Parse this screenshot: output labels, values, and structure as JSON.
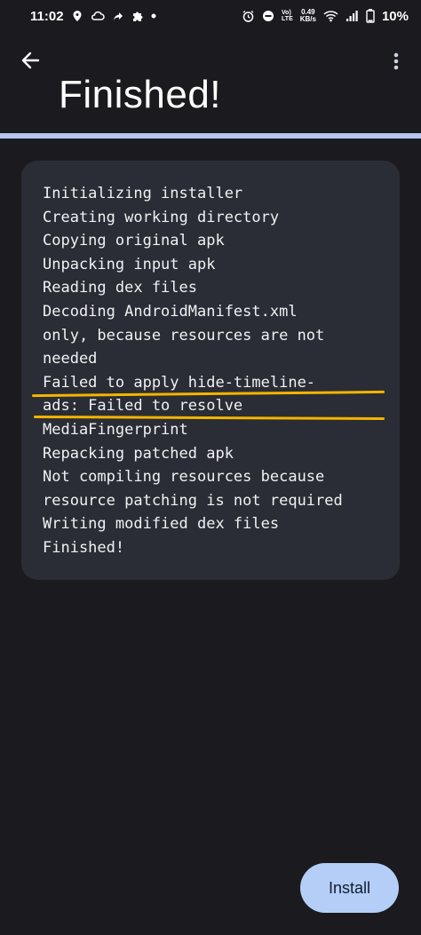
{
  "status_bar": {
    "time": "11:02",
    "volte_top": "Vo)",
    "volte_bottom": "LTE",
    "net_speed_value": "0.49",
    "net_speed_unit": "KB/s",
    "battery": "10%"
  },
  "app_bar": {
    "title": "Finished!"
  },
  "progress": {
    "value": 1.0
  },
  "log": {
    "lines": [
      "Initializing installer",
      "Creating working directory",
      "Copying original apk",
      "Unpacking input apk",
      "Reading dex files",
      "Decoding AndroidManifest.xml",
      "only, because resources are not",
      "needed",
      "Failed to apply hide-timeline-",
      "ads: Failed to resolve",
      "MediaFingerprint",
      "Repacking patched apk",
      "Not compiling resources because",
      "resource patching is not required",
      "Writing modified dex files",
      "Finished!"
    ]
  },
  "actions": {
    "install_label": "Install"
  },
  "colors": {
    "background": "#1b1b1f",
    "card": "#2a2d35",
    "accent": "#b4cef7",
    "highlight": "#f5b400"
  }
}
